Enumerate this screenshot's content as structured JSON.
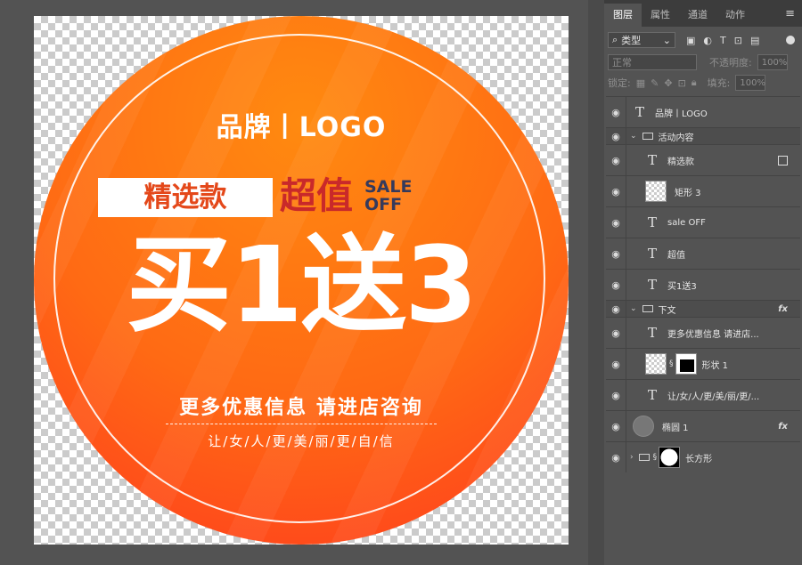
{
  "canvas": {
    "brand": "品牌丨LOGO",
    "tag_box": "精选款",
    "chaozhi": "超值",
    "sale_line1": "SALE",
    "sale_line2": "OFF",
    "headline": "买1送3",
    "more_info": "更多优惠信息 请进店咨询",
    "women": "让/女/人/更/美/丽/更/自/信",
    "colors": {
      "orange_top": "#ff8a10",
      "orange_bottom": "#ff3b1e",
      "chaozhi": "#c9292a",
      "sale": "#353a5c"
    }
  },
  "panel": {
    "tabs": [
      "图层",
      "属性",
      "通道",
      "动作"
    ],
    "filter_label": "类型",
    "blend_mode": "正常",
    "opacity_label": "不透明度:",
    "opacity_value": "100%",
    "lock_label": "锁定:",
    "fill_label": "填充:",
    "fill_value": "100%",
    "layers": [
      {
        "name": "品牌丨LOGO",
        "type": "text"
      },
      {
        "name": "活动内容",
        "type": "group"
      },
      {
        "name": "精选款",
        "type": "text"
      },
      {
        "name": "矩形 3",
        "type": "shape"
      },
      {
        "name": "sale OFF",
        "type": "text"
      },
      {
        "name": "超值",
        "type": "text"
      },
      {
        "name": "买1送3",
        "type": "text"
      },
      {
        "name": "下文",
        "type": "group"
      },
      {
        "name": "更多优惠信息 请进店...",
        "type": "text"
      },
      {
        "name": "形状 1",
        "type": "shape"
      },
      {
        "name": "让/女/人/更/美/丽/更/...",
        "type": "text"
      },
      {
        "name": "椭圆 1",
        "type": "shape"
      },
      {
        "name": "长方形",
        "type": "group"
      }
    ]
  }
}
